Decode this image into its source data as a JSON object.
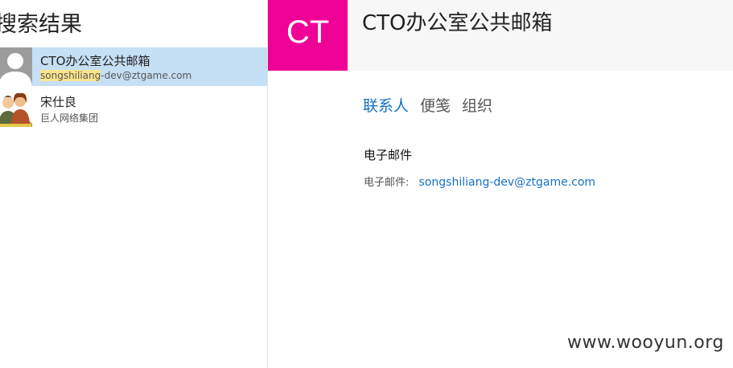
{
  "search": {
    "heading": "搜索结果"
  },
  "results": [
    {
      "name": "CTO办公室公共邮箱",
      "email_highlight": "songshiliang",
      "email_rest": "-dev@ztgame.com",
      "avatar": "default-person-icon"
    },
    {
      "name": "宋仕良",
      "subtitle": "巨人网络集团",
      "avatar": "group-people-icon"
    }
  ],
  "detail": {
    "tile_initials": "CT",
    "title": "CTO办公室公共邮箱",
    "tabs": [
      "联系人",
      "便笺",
      "组织"
    ],
    "section_title": "电子邮件",
    "email_label": "电子邮件:",
    "email_value": "songshiliang-dev@ztgame.com"
  },
  "watermark": "www.wooyun.org",
  "colors": {
    "tile": "#ef0097",
    "selected_row": "#c5dff5",
    "highlight": "#fce68c",
    "link": "#1570c5"
  }
}
